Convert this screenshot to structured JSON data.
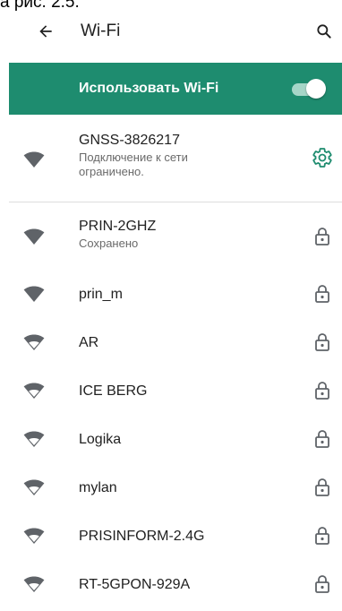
{
  "caption": "а рис. 2.5.",
  "header": {
    "title": "Wi-Fi"
  },
  "master_toggle": {
    "label": "Использовать Wi-Fi",
    "state": "on"
  },
  "connected": {
    "ssid": "GNSS-3826217",
    "status_line1": "Подключение к сети",
    "status_line2": "ограничено.",
    "signal_icon": "wifi-filled-icon",
    "action_icon": "gear-icon"
  },
  "networks": [
    {
      "ssid": "PRIN-2GHZ",
      "status": "Сохранено",
      "signal": "full",
      "action_icon": "lock-icon"
    },
    {
      "ssid": "prin_m",
      "status": "",
      "signal": "full",
      "action_icon": "lock-icon"
    },
    {
      "ssid": "AR",
      "status": "",
      "signal": "outline",
      "action_icon": "lock-icon"
    },
    {
      "ssid": "ICE BERG",
      "status": "",
      "signal": "outline",
      "action_icon": "lock-icon"
    },
    {
      "ssid": "Logika",
      "status": "",
      "signal": "outline",
      "action_icon": "lock-icon"
    },
    {
      "ssid": "mylan",
      "status": "",
      "signal": "outline",
      "action_icon": "lock-icon"
    },
    {
      "ssid": "PRISINFORM-2.4G",
      "status": "",
      "signal": "outline",
      "action_icon": "lock-icon"
    },
    {
      "ssid": "RT-5GPON-929A",
      "status": "",
      "signal": "outline",
      "action_icon": "lock-icon"
    }
  ],
  "colors": {
    "accent": "#1e8c6f",
    "icon": "#5f6368",
    "gear": "#1e8c6f"
  }
}
